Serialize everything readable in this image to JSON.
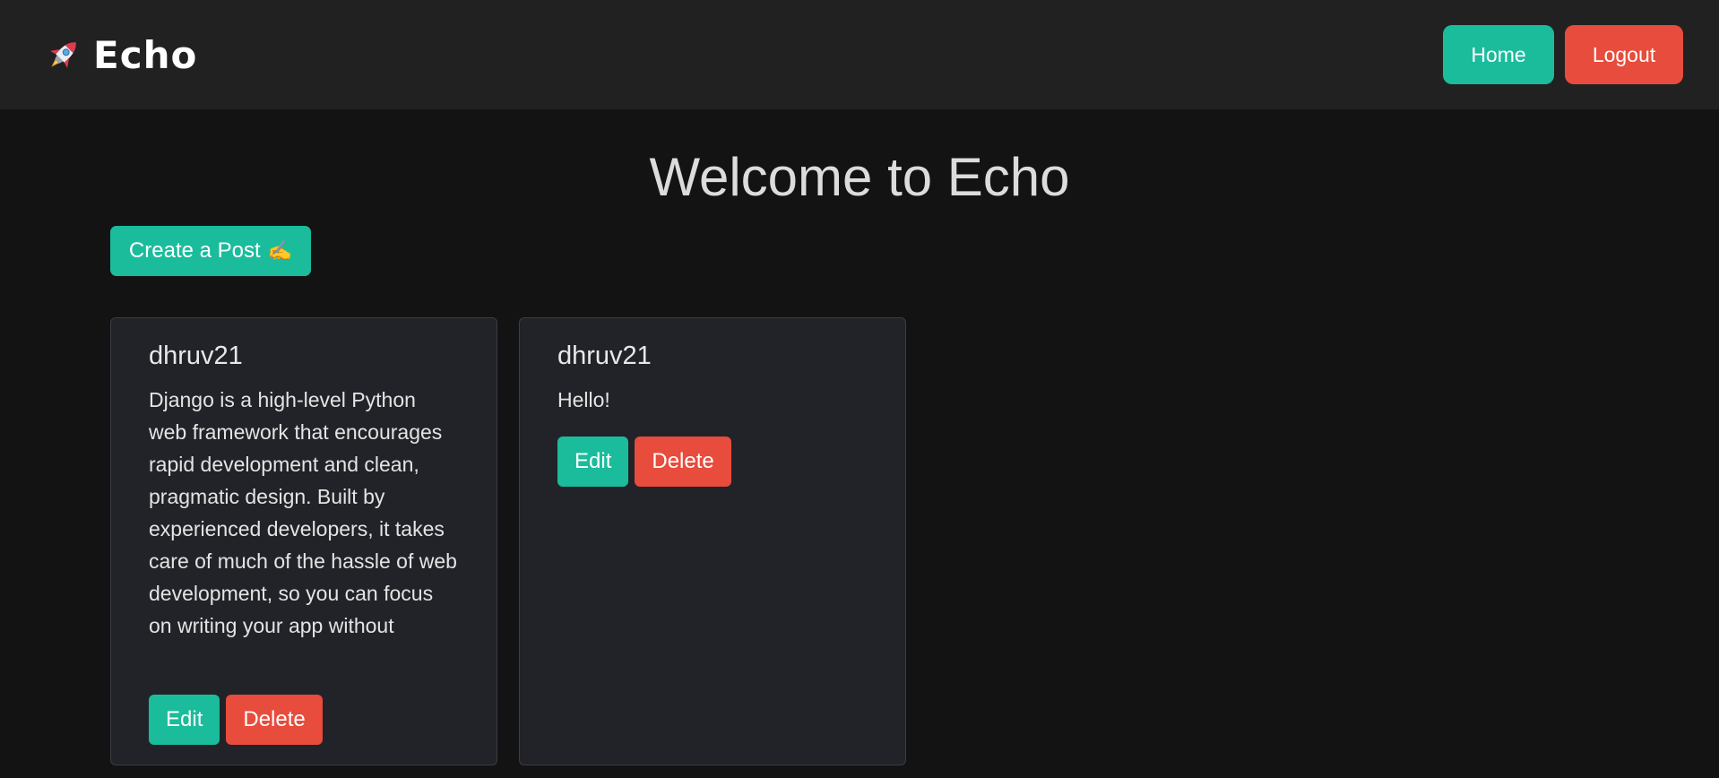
{
  "nav": {
    "brand": "Echo",
    "home_label": "Home",
    "logout_label": "Logout"
  },
  "main": {
    "title": "Welcome to Echo",
    "create_label": "Create a Post",
    "create_emoji": "✍️"
  },
  "posts": [
    {
      "author": "dhruv21",
      "content": "Django is a high-level Python web framework that encourages rapid development and clean, pragmatic design. Built by experienced developers, it takes care of much of the hassle of web development, so you can focus on writing your app without",
      "edit_label": "Edit",
      "delete_label": "Delete"
    },
    {
      "author": "dhruv21",
      "content": "Hello!",
      "edit_label": "Edit",
      "delete_label": "Delete"
    }
  ],
  "colors": {
    "accent_green": "#1abc9c",
    "danger_red": "#e74c3c",
    "navbar_bg": "#212121",
    "page_bg": "#131313",
    "card_bg": "#212328"
  },
  "icons": {
    "brand_icon": "rocket-icon"
  }
}
